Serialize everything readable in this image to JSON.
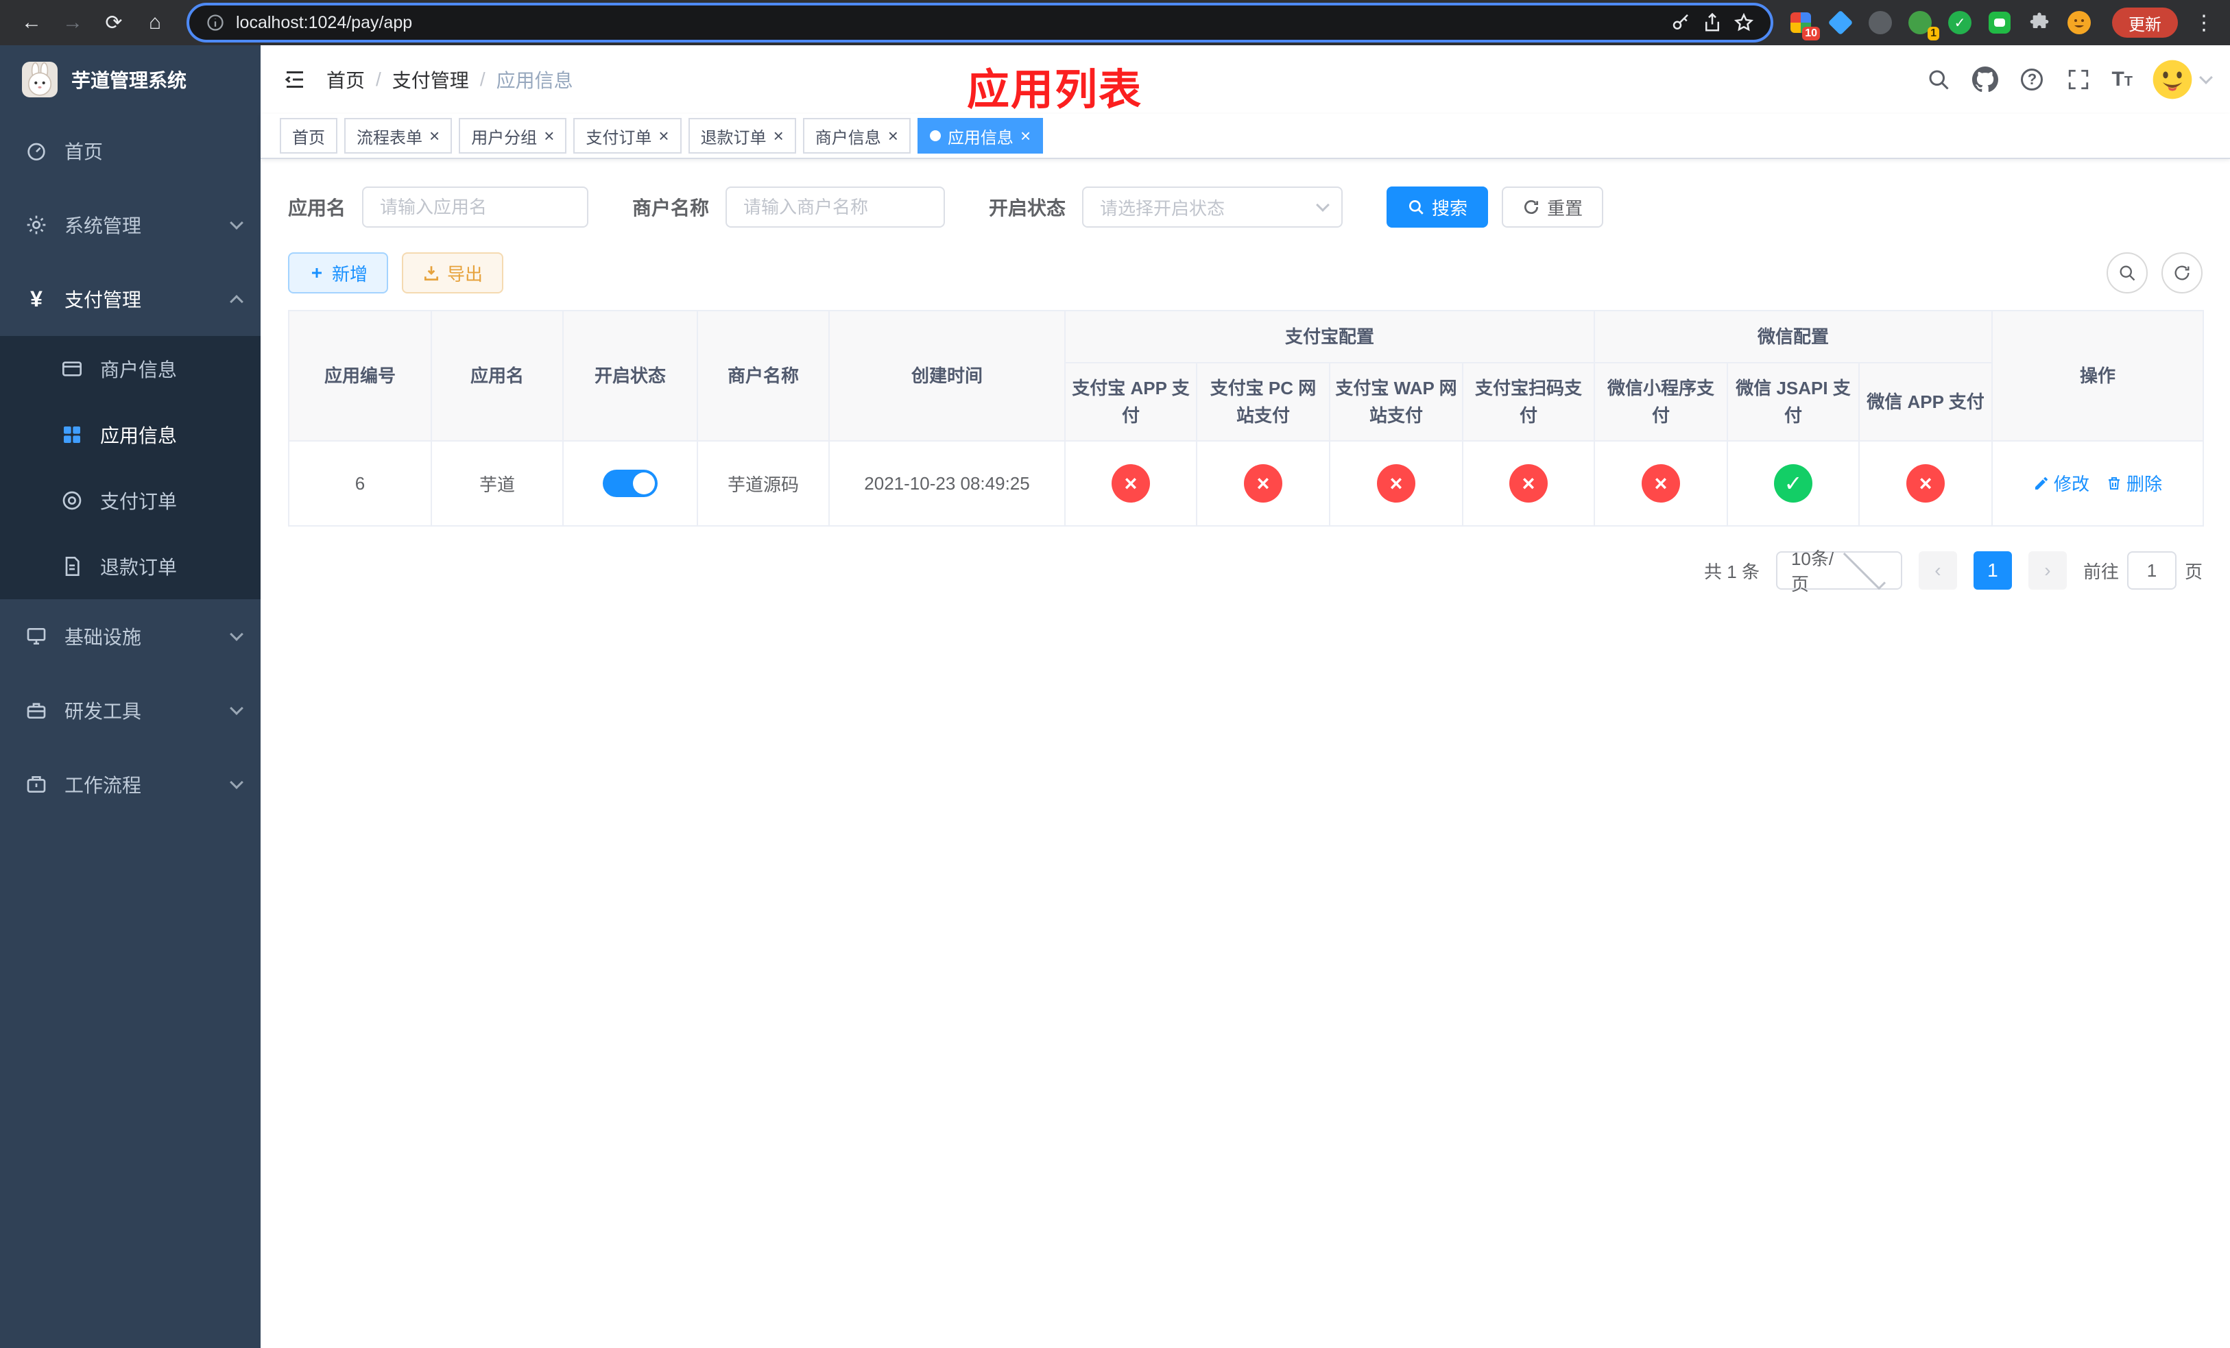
{
  "browser": {
    "url": "localhost:1024/pay/app",
    "update_button": "更新",
    "ext_badge_grid": "10",
    "ext_badge_avatar": "1"
  },
  "sidebar": {
    "title": "芋道管理系统",
    "items": [
      {
        "label": "首页"
      },
      {
        "label": "系统管理"
      },
      {
        "label": "支付管理"
      },
      {
        "label": "基础设施"
      },
      {
        "label": "研发工具"
      },
      {
        "label": "工作流程"
      }
    ],
    "payment_children": [
      {
        "label": "商户信息"
      },
      {
        "label": "应用信息"
      },
      {
        "label": "支付订单"
      },
      {
        "label": "退款订单"
      }
    ]
  },
  "header": {
    "breadcrumb": [
      "首页",
      "支付管理",
      "应用信息"
    ],
    "annotation": "应用列表"
  },
  "tabs": [
    {
      "label": "首页"
    },
    {
      "label": "流程表单"
    },
    {
      "label": "用户分组"
    },
    {
      "label": "支付订单"
    },
    {
      "label": "退款订单"
    },
    {
      "label": "商户信息"
    },
    {
      "label": "应用信息"
    }
  ],
  "filters": {
    "app_name_label": "应用名",
    "app_name_placeholder": "请输入应用名",
    "merchant_label": "商户名称",
    "merchant_placeholder": "请输入商户名称",
    "status_label": "开启状态",
    "status_placeholder": "请选择开启状态",
    "search_button": "搜索",
    "reset_button": "重置"
  },
  "toolbar": {
    "add_button": "新增",
    "export_button": "导出"
  },
  "table": {
    "col_headers": [
      "应用编号",
      "应用名",
      "开启状态",
      "商户名称",
      "创建时间"
    ],
    "alipay_group": "支付宝配置",
    "wechat_group": "微信配置",
    "alipay_cols": [
      "支付宝 APP 支付",
      "支付宝 PC 网站支付",
      "支付宝 WAP 网站支付",
      "支付宝扫码支付"
    ],
    "wechat_cols": [
      "微信小程序支付",
      "微信 JSAPI 支付",
      "微信 APP 支付"
    ],
    "ops_header": "操作",
    "row": {
      "id": "6",
      "name": "芋道",
      "enabled": true,
      "merchant": "芋道源码",
      "create_time": "2021-10-23 08:49:25",
      "configs": [
        "no",
        "no",
        "no",
        "no",
        "no",
        "yes",
        "no"
      ],
      "edit_label": "修改",
      "delete_label": "删除"
    }
  },
  "pagination": {
    "total": "共 1 条",
    "page_size": "10条/页",
    "current_page": "1",
    "goto_prefix": "前往",
    "goto_value": "1",
    "goto_suffix": "页"
  },
  "colors": {
    "primary": "#1890ff",
    "menu_active": "#409eff",
    "success": "#13ce66",
    "danger": "#ff4949",
    "warning": "#e6a23c",
    "annotation_red": "#fb1f1f"
  }
}
